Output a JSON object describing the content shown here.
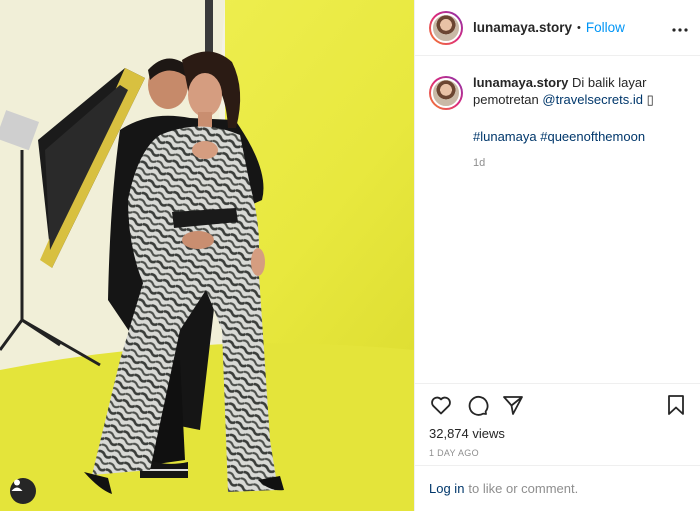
{
  "post": {
    "username": "lunamaya.story",
    "follow_label": "Follow",
    "separator": "•",
    "more_label": "•••"
  },
  "caption": {
    "username": "lunamaya.story",
    "text_line1": "Di balik layar",
    "text_line2": "pemotretan",
    "mention": "@travelsecrets.id",
    "trailing_glyph": "▯",
    "hashtag1": "#lunamaya",
    "hashtag2": "#queenofthemoon",
    "time_ago": "1d"
  },
  "stats": {
    "views": "32,874 views",
    "date": "1 DAY AGO"
  },
  "footer": {
    "login_label": "Log in",
    "suffix": "to like or comment."
  },
  "icons": {
    "like": "heart-icon",
    "comment": "comment-icon",
    "share": "share-icon",
    "save": "bookmark-icon",
    "tagged": "user-tag-icon"
  },
  "colors": {
    "accent": "#0095f6",
    "link": "#00376b",
    "backdrop": "#ecec46"
  }
}
